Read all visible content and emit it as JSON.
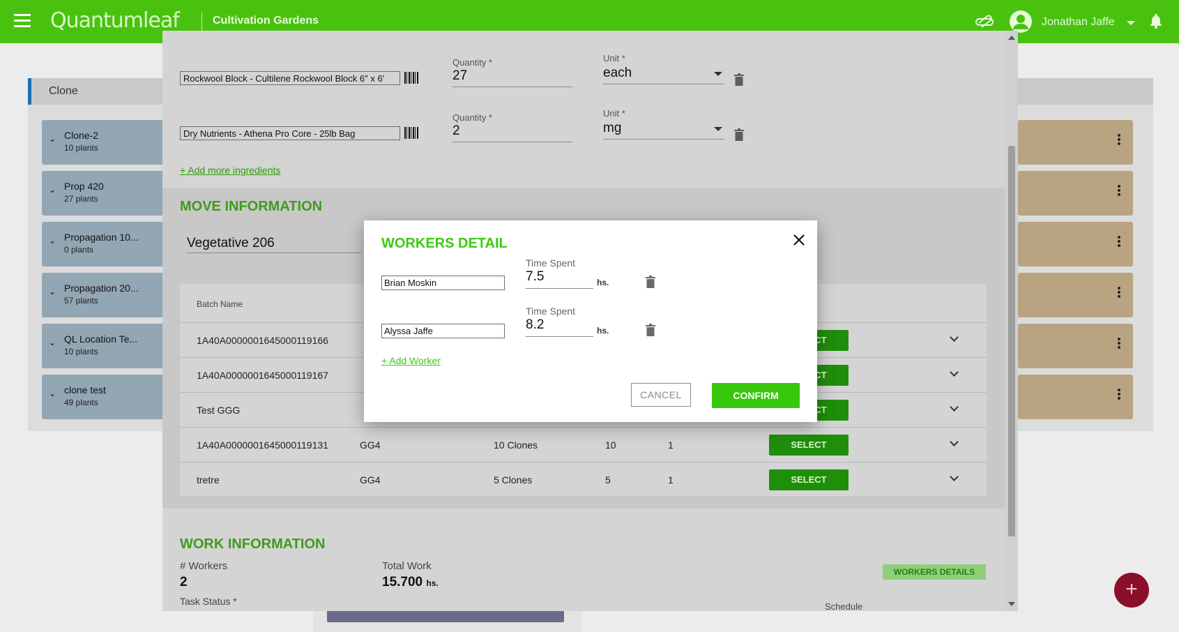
{
  "app": {
    "logo": "Quantumleaf",
    "org_name": "Cultivation Gardens",
    "user_name": "Jonathan Jaffe"
  },
  "background": {
    "section_label": "Clone",
    "locations": [
      {
        "name": "Clone-2",
        "plants": "10 plants"
      },
      {
        "name": "Prop 420",
        "plants": "27 plants"
      },
      {
        "name": "Propagation 10...",
        "plants": "0 plants"
      },
      {
        "name": "Propagation 20...",
        "plants": "57 plants"
      },
      {
        "name": "QL Location Te...",
        "plants": "10 plants"
      },
      {
        "name": "clone test",
        "plants": "49 plants"
      }
    ],
    "fab_label": "+"
  },
  "task_modal": {
    "ingredients": [
      {
        "item": "Rockwool Block - Cultilene Rockwool Block 6\" x 6'",
        "qty_label": "Quantity *",
        "qty": "27",
        "unit_label": "Unit *",
        "unit": "each"
      },
      {
        "item": "Dry Nutrients - Athena Pro Core - 25lb Bag",
        "qty_label": "Quantity *",
        "qty": "2",
        "unit_label": "Unit *",
        "unit": "mg"
      }
    ],
    "add_ingredients": "+ Add more ingredients",
    "move_title": "MOVE INFORMATION",
    "destination": "Vegetative 206",
    "table": {
      "header": "Batch Name",
      "rows": [
        {
          "batch": "1A40A0000001645000119166",
          "strain": "",
          "type": "",
          "count": "",
          "n": "",
          "button": "SELECT"
        },
        {
          "batch": "1A40A0000001645000119167",
          "strain": "",
          "type": "",
          "count": "",
          "n": "",
          "button": "SELECT"
        },
        {
          "batch": "Test GGG",
          "strain": "",
          "type": "",
          "count": "",
          "n": "",
          "button": "SELECT"
        },
        {
          "batch": "1A40A0000001645000119131",
          "strain": "GG4",
          "type": "10 Clones",
          "count": "10",
          "n": "1",
          "button": "SELECT"
        },
        {
          "batch": "tretre",
          "strain": "GG4",
          "type": "5 Clones",
          "count": "5",
          "n": "1",
          "button": "SELECT"
        }
      ]
    },
    "work_title": "WORK INFORMATION",
    "workers_label": "# Workers",
    "workers_value": "2",
    "total_label": "Total Work",
    "total_value": "15.700",
    "total_unit": "hs.",
    "workers_details_btn": "WORKERS DETAILS",
    "task_status_label": "Task Status *",
    "schedule_label": "Schedule"
  },
  "workers_dialog": {
    "title": "WORKERS DETAIL",
    "workers": [
      {
        "name": "Brian Moskin",
        "time_label": "Time Spent",
        "time": "7.5",
        "unit": "hs."
      },
      {
        "name": "Alyssa Jaffe",
        "time_label": "Time Spent",
        "time": "8.2",
        "unit": "hs."
      }
    ],
    "add_worker": "+ Add Worker",
    "cancel": "CANCEL",
    "confirm": "CONFIRM"
  },
  "colors": {
    "brand_green": "#48c20f",
    "title_green": "#3fc80f",
    "fab": "#8c0f2a"
  }
}
